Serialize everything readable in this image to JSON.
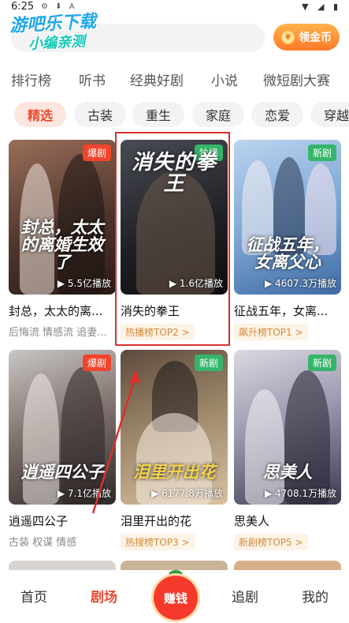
{
  "status_bar": {
    "time": "6:25",
    "icons_left": "⚙ ⬇ A",
    "icons_right": "▼ ◢ ▮"
  },
  "watermark": {
    "line1": "游吧乐下载",
    "line2": "小编亲测"
  },
  "header": {
    "coin_label": "领金币",
    "coin_symbol": "¥"
  },
  "category_tabs": [
    "排行榜",
    "听书",
    "经典好剧",
    "小说",
    "微短剧大赛"
  ],
  "chips": [
    "精选",
    "古装",
    "重生",
    "家庭",
    "恋爱",
    "穿越"
  ],
  "cards": [
    {
      "poster_title": "封总，太太的离婚生效了",
      "badge": "爆剧",
      "badge_color": "red",
      "plays": "5.5亿播放",
      "title": "封总，太太的离...",
      "tags": "后悔流 情感流 追妻...",
      "rank": ""
    },
    {
      "poster_title": "消失的拳王",
      "badge": "独播",
      "badge_color": "green",
      "plays": "1.6亿播放",
      "title": "消失的拳王",
      "tags": "",
      "rank": "热播榜TOP2 >"
    },
    {
      "poster_title": "征战五年，女离父心",
      "badge": "新剧",
      "badge_color": "green",
      "plays": "4607.3万播放",
      "title": "征战五年，女离...",
      "tags": "",
      "rank": "飙升榜TOP1 >"
    },
    {
      "poster_title": "逍遥四公子",
      "badge": "爆剧",
      "badge_color": "red",
      "plays": "7.1亿播放",
      "title": "逍遥四公子",
      "tags": "古装 权谋 情感",
      "rank": ""
    },
    {
      "poster_title": "泪里开出花",
      "badge": "新剧",
      "badge_color": "green",
      "plays": "6177.8万播放",
      "title": "泪里开出的花",
      "tags": "",
      "rank": "热搜榜TOP3 >"
    },
    {
      "poster_title": "思美人",
      "badge": "新剧",
      "badge_color": "green",
      "plays": "4708.1万播放",
      "title": "思美人",
      "tags": "",
      "rank": "新剧榜TOP5 >"
    }
  ],
  "bottom_nav": {
    "home": "首页",
    "theater": "剧场",
    "earn": "赚钱",
    "follow": "追剧",
    "mine": "我的"
  }
}
